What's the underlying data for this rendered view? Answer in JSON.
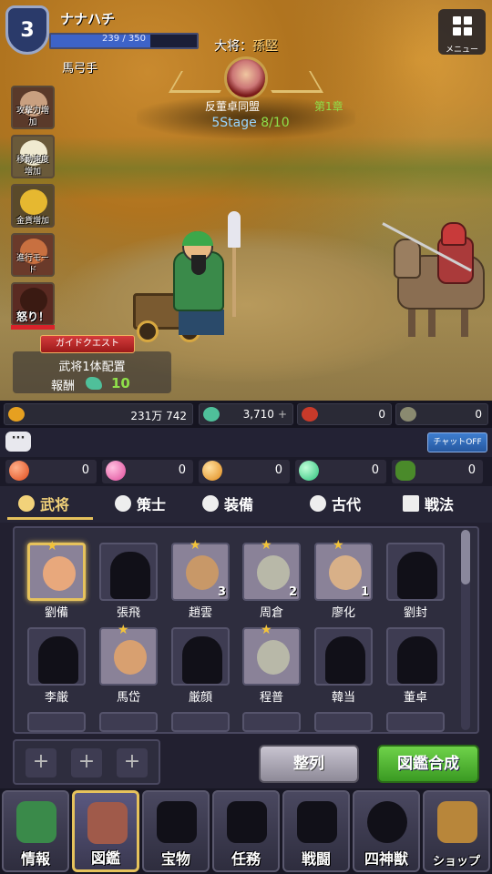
{
  "player": {
    "level": "3",
    "name": "ナナハチ",
    "xp_text": "239 / 350",
    "xp_fraction": 0.683,
    "title": "馬弓手"
  },
  "menu": {
    "label": "メニュー"
  },
  "boss": {
    "label": "大将：",
    "name": "孫堅"
  },
  "stage": {
    "name": "反董卓同盟",
    "chapter": "第1章",
    "label": "5Stage",
    "progress": "8/10"
  },
  "skills": [
    {
      "label": "攻撃力増加"
    },
    {
      "label": "移動速度増加"
    },
    {
      "label": "金貨増加"
    },
    {
      "label": "進行モード"
    },
    {
      "label": "怒り！"
    }
  ],
  "guide": {
    "button": "ガイドクエスト",
    "task": "武将1体配置",
    "reward_label": "報酬",
    "reward_value": "10"
  },
  "resources": {
    "gold": "231万 742",
    "dragon": "3,710",
    "axe": "0",
    "pot": "0"
  },
  "chat": {
    "toggle": "チャットOFF"
  },
  "orbs": [
    "0",
    "0",
    "0",
    "0",
    "0"
  ],
  "tabs": [
    "武将",
    "策士",
    "装備",
    "古代",
    "戦法"
  ],
  "generals": [
    {
      "name": "劉備",
      "owned": true,
      "selected": true,
      "star": true,
      "count": ""
    },
    {
      "name": "張飛",
      "owned": false,
      "selected": false,
      "star": false,
      "count": ""
    },
    {
      "name": "趙雲",
      "owned": true,
      "selected": false,
      "star": true,
      "count": "3"
    },
    {
      "name": "周倉",
      "owned": true,
      "selected": false,
      "star": true,
      "count": "2"
    },
    {
      "name": "廖化",
      "owned": true,
      "selected": false,
      "star": true,
      "count": "1"
    },
    {
      "name": "劉封",
      "owned": false,
      "selected": false,
      "star": false,
      "count": ""
    },
    {
      "name": "李厳",
      "owned": false,
      "selected": false,
      "star": false,
      "count": ""
    },
    {
      "name": "馬岱",
      "owned": true,
      "selected": false,
      "star": true,
      "count": ""
    },
    {
      "name": "厳顔",
      "owned": false,
      "selected": false,
      "star": false,
      "count": ""
    },
    {
      "name": "程普",
      "owned": true,
      "selected": false,
      "star": true,
      "count": ""
    },
    {
      "name": "韓当",
      "owned": false,
      "selected": false,
      "star": false,
      "count": ""
    },
    {
      "name": "董卓",
      "owned": false,
      "selected": false,
      "star": false,
      "count": ""
    }
  ],
  "actions": {
    "slot_symbol": "+",
    "sort": "整列",
    "fuse": "図鑑合成"
  },
  "nav": [
    "情報",
    "図鑑",
    "宝物",
    "任務",
    "戦闘",
    "四神獣",
    "ショップ"
  ],
  "colors": {
    "accent_gold": "#e6c25c",
    "green": "#8fe04a",
    "red": "#d8222a"
  }
}
